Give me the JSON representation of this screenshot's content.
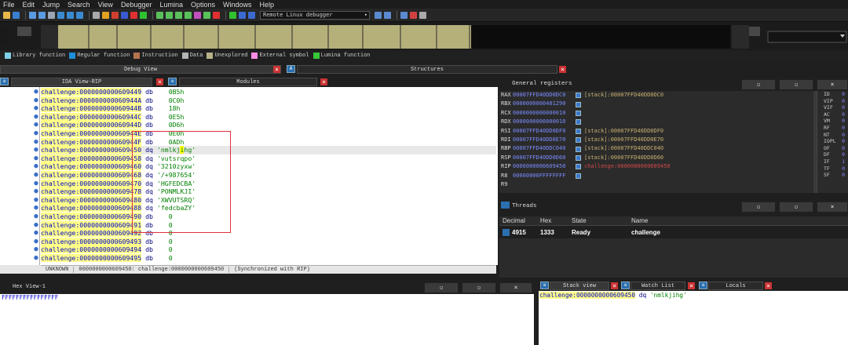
{
  "menu": [
    "File",
    "Edit",
    "Jump",
    "Search",
    "View",
    "Debugger",
    "Lumina",
    "Options",
    "Windows",
    "Help"
  ],
  "toolbar": {
    "debugger_select": "Remote Linux debugger"
  },
  "legend": [
    {
      "label": "Library function",
      "color": "#7fcfe8"
    },
    {
      "label": "Regular function",
      "color": "#1e8fd8"
    },
    {
      "label": "Instruction",
      "color": "#b3744e"
    },
    {
      "label": "Data",
      "color": "#b4b4b4"
    },
    {
      "label": "Unexplored",
      "color": "#b8b28a"
    },
    {
      "label": "External symbol",
      "color": "#ff8ce6"
    },
    {
      "label": "Lumina function",
      "color": "#37c737"
    }
  ],
  "tabs": {
    "debug_view": "Debug View",
    "structures": "Structures",
    "ida_view": "IDA View-RIP",
    "modules": "Modules",
    "hex_view": "Hex View-1",
    "stack_view": "Stack view",
    "watch_list": "Watch List",
    "locals": "Locals"
  },
  "disasm": [
    {
      "addr": "challenge:0000000000609449",
      "op": "db",
      "val": "0B5h",
      "kind": "num"
    },
    {
      "addr": "challenge:000000000060944A",
      "op": "db",
      "val": "0C0h",
      "kind": "num"
    },
    {
      "addr": "challenge:000000000060944B",
      "op": "db",
      "val": "18h",
      "kind": "num"
    },
    {
      "addr": "challenge:000000000060944C",
      "op": "db",
      "val": "0E5h",
      "kind": "num"
    },
    {
      "addr": "challenge:000000000060944D",
      "op": "db",
      "val": "0D6h",
      "kind": "num"
    },
    {
      "addr": "challenge:000000000060944E",
      "op": "db",
      "val": "0E0h",
      "kind": "num"
    },
    {
      "addr": "challenge:000000000060944F",
      "op": "db",
      "val": "0ADh",
      "kind": "num"
    },
    {
      "addr": "challenge:0000000000609450",
      "op": "dq",
      "val": "'nmlkjihg'",
      "kind": "str",
      "current": true
    },
    {
      "addr": "challenge:0000000000609458",
      "op": "dq",
      "val": "'vutsrqpo'",
      "kind": "str"
    },
    {
      "addr": "challenge:0000000000609460",
      "op": "dq",
      "val": "'3210zyxw'",
      "kind": "str"
    },
    {
      "addr": "challenge:0000000000609468",
      "op": "dq",
      "val": "'/+987654'",
      "kind": "str"
    },
    {
      "addr": "challenge:0000000000609470",
      "op": "dq",
      "val": "'HGFEDCBA'",
      "kind": "str"
    },
    {
      "addr": "challenge:0000000000609478",
      "op": "dq",
      "val": "'PONMLKJI'",
      "kind": "str"
    },
    {
      "addr": "challenge:0000000000609480",
      "op": "dq",
      "val": "'XWVUTSRQ'",
      "kind": "str"
    },
    {
      "addr": "challenge:0000000000609488",
      "op": "dq",
      "val": "'fedcbaZY'",
      "kind": "str"
    },
    {
      "addr": "challenge:0000000000609490",
      "op": "db",
      "val": "0",
      "kind": "num"
    },
    {
      "addr": "challenge:0000000000609491",
      "op": "db",
      "val": "0",
      "kind": "num"
    },
    {
      "addr": "challenge:0000000000609492",
      "op": "db",
      "val": "0",
      "kind": "num"
    },
    {
      "addr": "challenge:0000000000609493",
      "op": "db",
      "val": "0",
      "kind": "num"
    },
    {
      "addr": "challenge:0000000000609494",
      "op": "db",
      "val": "0",
      "kind": "num"
    },
    {
      "addr": "challenge:0000000000609495",
      "op": "db",
      "val": "0",
      "kind": "num"
    }
  ],
  "status": {
    "mode": "UNKNOWN",
    "location": "0000000000609450: challenge:0000000000609450",
    "sync": "(Synchronized with RIP)"
  },
  "registers": {
    "title": "General registers",
    "rows": [
      {
        "name": "RAX",
        "value": "00007FFD40DD0DC0",
        "comment": "[stack]:00007FFD40DD0DC0",
        "style": "stk"
      },
      {
        "name": "RBX",
        "value": "0000000000401290",
        "comment": "",
        "style": ""
      },
      {
        "name": "RCX",
        "value": "0000000000000010",
        "comment": "",
        "style": ""
      },
      {
        "name": "RDX",
        "value": "0000000000000010",
        "comment": "",
        "style": ""
      },
      {
        "name": "RSI",
        "value": "00007FFD40DD0DF0",
        "comment": "[stack]:00007FFD40DD0DF0",
        "style": "stk"
      },
      {
        "name": "RDI",
        "value": "00007FFD40DD0E70",
        "comment": "[stack]:00007FFD40DD0E70",
        "style": "stk"
      },
      {
        "name": "RBP",
        "value": "00007FFD40DDC040",
        "comment": "[stack]:00007FFD40DDC040",
        "style": "stk"
      },
      {
        "name": "RSP",
        "value": "00007FFD40DD0D60",
        "comment": "[stack]:00007FFD40DD0D60",
        "style": "stk"
      },
      {
        "name": "RIP",
        "value": "0000000000609450",
        "comment": "challenge:0000000000609450",
        "style": "rip"
      },
      {
        "name": "R8",
        "value": "00000000FFFFFFFF",
        "comment": "",
        "style": ""
      },
      {
        "name": "R9",
        "value": "",
        "comment": "",
        "style": ""
      }
    ],
    "flags": [
      {
        "name": "ID",
        "val": "0"
      },
      {
        "name": "VIP",
        "val": "0"
      },
      {
        "name": "VIF",
        "val": "0"
      },
      {
        "name": "AC",
        "val": "0"
      },
      {
        "name": "VM",
        "val": "0"
      },
      {
        "name": "RF",
        "val": "0"
      },
      {
        "name": "NT",
        "val": "0"
      },
      {
        "name": "IOPL",
        "val": "0"
      },
      {
        "name": "OF",
        "val": "0"
      },
      {
        "name": "DF",
        "val": "0"
      },
      {
        "name": "IF",
        "val": "1"
      },
      {
        "name": "TF",
        "val": "0"
      },
      {
        "name": "SF",
        "val": "0"
      }
    ]
  },
  "threads": {
    "title": "Threads",
    "columns": [
      "Decimal",
      "Hex",
      "State",
      "Name"
    ],
    "rows": [
      {
        "decimal": "4915",
        "hex": "1333",
        "state": "Ready",
        "name": "challenge"
      }
    ]
  },
  "hex": {
    "line": "FFFFFFFFFFFFFFFF"
  },
  "stack": {
    "addr": "challenge:0000000000609450",
    "op": "dq",
    "val": "'nmlkjihg'"
  }
}
